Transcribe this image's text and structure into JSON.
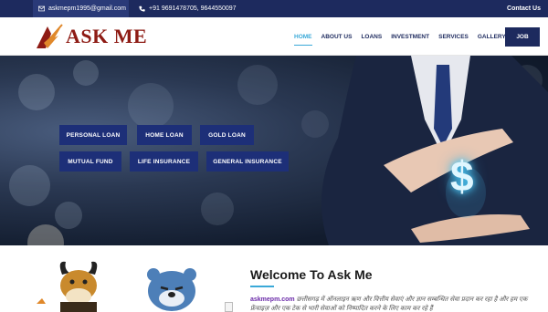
{
  "topbar": {
    "email": "askmepm1995@gmail.com",
    "phone": "+91 9691478705, 9644550097",
    "contact_label": "Contact Us"
  },
  "brand": {
    "logo_text": "ASK ME"
  },
  "nav": {
    "items": [
      "HOME",
      "ABOUT US",
      "LOANS",
      "INVESTMENT",
      "SERVICES",
      "GALLERY"
    ],
    "active": "HOME",
    "job_label": "JOB"
  },
  "hero": {
    "buttons_row1": [
      "PERSONAL LOAN",
      "HOME LOAN",
      "GOLD LOAN"
    ],
    "buttons_row2": [
      "MUTUAL FUND",
      "LIFE INSURANCE",
      "GENERAL INSURANCE"
    ],
    "dollar_symbol": "$"
  },
  "welcome": {
    "title": "Welcome To Ask Me",
    "brand_link": "askmepm.com",
    "text": "छत्तीसगढ़ में ऑनलाइन ऋण और वित्तीय सेवाएं और ज्ञान सम्बन्धित सेवा प्रदान कर रहा है और हम एक फ्रेंचाइज़ और एक टेक से भारी सेवाओं को निष्पादित करने के लिए काम कर रहे हैं"
  },
  "colors": {
    "navy": "#1d2a5e",
    "accent_blue": "#3aa9d8",
    "logo_red": "#8e1b14",
    "hero_button": "#1d2f78"
  },
  "icons": [
    "envelope-icon",
    "phone-icon",
    "logo-mark-icon",
    "bull-mascot",
    "bear-mascot"
  ]
}
